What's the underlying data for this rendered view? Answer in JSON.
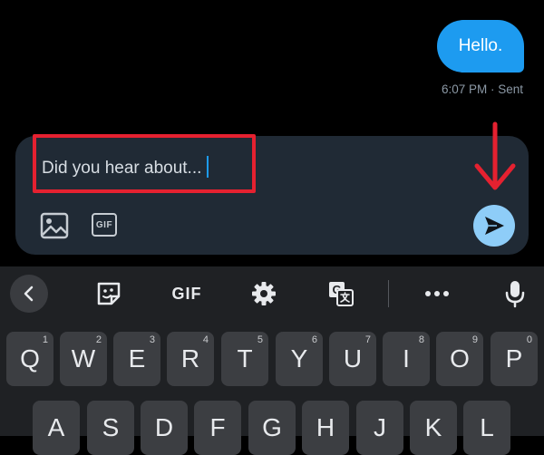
{
  "conversation": {
    "message_text": "Hello.",
    "message_meta": "6:07 PM · Sent"
  },
  "composer": {
    "input_value": "Did you hear about...",
    "gif_label": "GIF",
    "icons": [
      "image-icon",
      "gif-icon",
      "send-icon"
    ]
  },
  "annotations": {
    "highlight_color": "#e52130",
    "arrow_color": "#e52130"
  },
  "keyboard": {
    "toolbar": {
      "gif_label": "GIF",
      "icons": [
        "chevron-left-icon",
        "sticker-icon",
        "gear-icon",
        "translate-icon",
        "more-icon",
        "microphone-icon"
      ]
    },
    "row1": [
      {
        "label": "Q",
        "hint": "1"
      },
      {
        "label": "W",
        "hint": "2"
      },
      {
        "label": "E",
        "hint": "3"
      },
      {
        "label": "R",
        "hint": "4"
      },
      {
        "label": "T",
        "hint": "5"
      },
      {
        "label": "Y",
        "hint": "6"
      },
      {
        "label": "U",
        "hint": "7"
      },
      {
        "label": "I",
        "hint": "8"
      },
      {
        "label": "O",
        "hint": "9"
      },
      {
        "label": "P",
        "hint": "0"
      }
    ],
    "row2": [
      {
        "label": "A"
      },
      {
        "label": "S"
      },
      {
        "label": "D"
      },
      {
        "label": "F"
      },
      {
        "label": "G"
      },
      {
        "label": "H"
      },
      {
        "label": "J"
      },
      {
        "label": "K"
      },
      {
        "label": "L"
      }
    ]
  },
  "colors": {
    "accent": "#1d9bf0",
    "send_button": "#8ecdf8",
    "composer_bg": "#202a35",
    "keyboard_bg": "#1f2124",
    "key_bg": "#3c3e42"
  }
}
